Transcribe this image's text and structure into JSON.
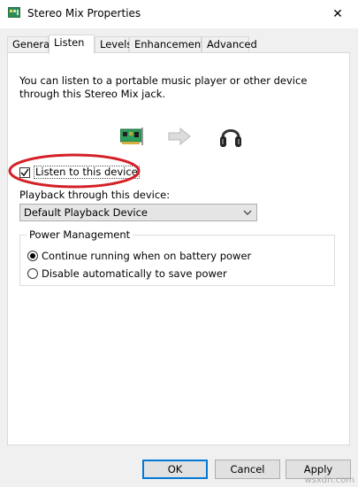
{
  "window": {
    "title": "Stereo Mix Properties",
    "close_glyph": "✕"
  },
  "tabs": [
    {
      "label": "General",
      "active": false
    },
    {
      "label": "Listen",
      "active": true
    },
    {
      "label": "Levels",
      "active": false
    },
    {
      "label": "Enhancements",
      "active": false
    },
    {
      "label": "Advanced",
      "active": false
    }
  ],
  "listen": {
    "description": "You can listen to a portable music player or other device through this Stereo Mix jack.",
    "listen_checkbox_label": "Listen to this device",
    "listen_checked": true,
    "playback_label": "Playback through this device:",
    "playback_device": "Default Playback Device",
    "icons": [
      "sound-card-icon",
      "right-arrow-icon",
      "headphones-icon"
    ]
  },
  "power": {
    "group_title": "Power Management",
    "options": [
      {
        "label": "Continue running when on battery power",
        "selected": true
      },
      {
        "label": "Disable automatically to save power",
        "selected": false
      }
    ]
  },
  "buttons": {
    "ok": "OK",
    "cancel": "Cancel",
    "apply": "Apply"
  },
  "colors": {
    "accent": "#0078d7",
    "highlight_ellipse": "#d42027"
  },
  "watermark": "wsxdn.com"
}
